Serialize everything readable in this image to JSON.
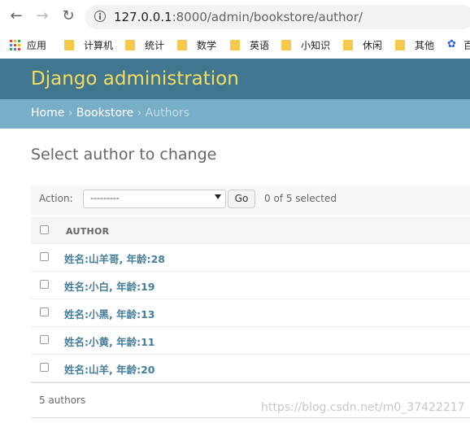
{
  "browser": {
    "url_host": "127.0.0.1",
    "url_rest": ":8000/admin/bookstore/author/",
    "bookmarks": [
      "应用",
      "计算机",
      "统计",
      "数学",
      "英语",
      "小知识",
      "休闲",
      "其他",
      "百"
    ]
  },
  "header": {
    "title": "Django administration"
  },
  "breadcrumbs": {
    "home": "Home",
    "sep1": "›",
    "app": "Bookstore",
    "sep2": "›",
    "current": "Authors"
  },
  "page": {
    "title": "Select author to change"
  },
  "actions": {
    "label": "Action:",
    "selected_value": "---------",
    "go_label": "Go",
    "selected_count": "0 of 5 selected"
  },
  "table": {
    "column_header": "AUTHOR",
    "rows": [
      "姓名:山羊哥, 年龄:28",
      "姓名:小白, 年龄:19",
      "姓名:小黑, 年龄:13",
      "姓名:小黄, 年龄:11",
      "姓名:山羊, 年龄:20"
    ]
  },
  "paginator": {
    "text": "5 authors"
  },
  "watermark": "https://blog.csdn.net/m0_37422217",
  "colors": {
    "header_bg": "#417690",
    "title": "#f5dd5d",
    "breadcrumb_bg": "#79aec8",
    "link": "#447e9b"
  }
}
